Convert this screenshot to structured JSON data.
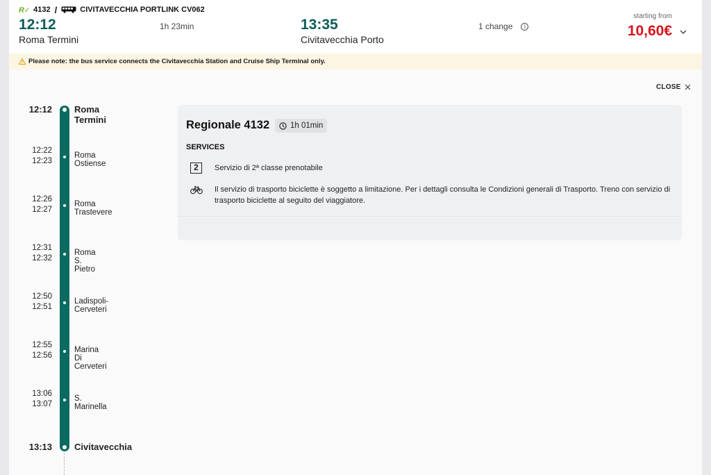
{
  "header": {
    "train_number": "4132",
    "bus_label": "CIVITAVECCHIA PORTLINK CV062",
    "departure": {
      "time": "12:12",
      "station": "Roma Termini"
    },
    "duration": "1h 23min",
    "arrival": {
      "time": "13:35",
      "station": "Civitavecchia Porto"
    },
    "changes": "1 change",
    "starting_from": "starting from",
    "price": "10,60€"
  },
  "notice": "Please note: the bus service connects the Civitavecchia Station and Cruise Ship Terminal only.",
  "close_label": "CLOSE",
  "stops": [
    {
      "arrive": "12:12",
      "depart": "",
      "name": "Roma Termini",
      "main": true
    },
    {
      "arrive": "12:22",
      "depart": "12:23",
      "name": "Roma Ostiense",
      "main": false
    },
    {
      "arrive": "12:26",
      "depart": "12:27",
      "name": "Roma Trastevere",
      "main": false
    },
    {
      "arrive": "12:31",
      "depart": "12:32",
      "name": "Roma S. Pietro",
      "main": false
    },
    {
      "arrive": "12:50",
      "depart": "12:51",
      "name": "Ladispoli-Cerveteri",
      "main": false
    },
    {
      "arrive": "12:55",
      "depart": "12:56",
      "name": "Marina Di Cerveteri",
      "main": false
    },
    {
      "arrive": "13:06",
      "depart": "13:07",
      "name": "S. Marinella",
      "main": false
    },
    {
      "arrive": "13:13",
      "depart": "",
      "name": "Civitavecchia",
      "main": true
    }
  ],
  "card": {
    "title": "Regionale 4132",
    "duration": "1h 01min",
    "services_label": "SERVICES",
    "services": [
      {
        "icon": "second-class-icon",
        "icon_text": "2",
        "text": "Servizio di 2ª classe prenotabile"
      },
      {
        "icon": "bicycle-icon",
        "text": "Il servizio di trasporto biciclette è soggetto a limitazione. Per i dettagli consulta le Condizioni generali di Trasporto. Treno con servizio di trasporto biciclette al seguito del viaggiatore."
      }
    ]
  },
  "colors": {
    "accent": "#0b5e56",
    "line": "#0b6b60",
    "price": "#d8141e",
    "notice_bg": "#fdf5e3",
    "brand_green": "#6ab023"
  }
}
